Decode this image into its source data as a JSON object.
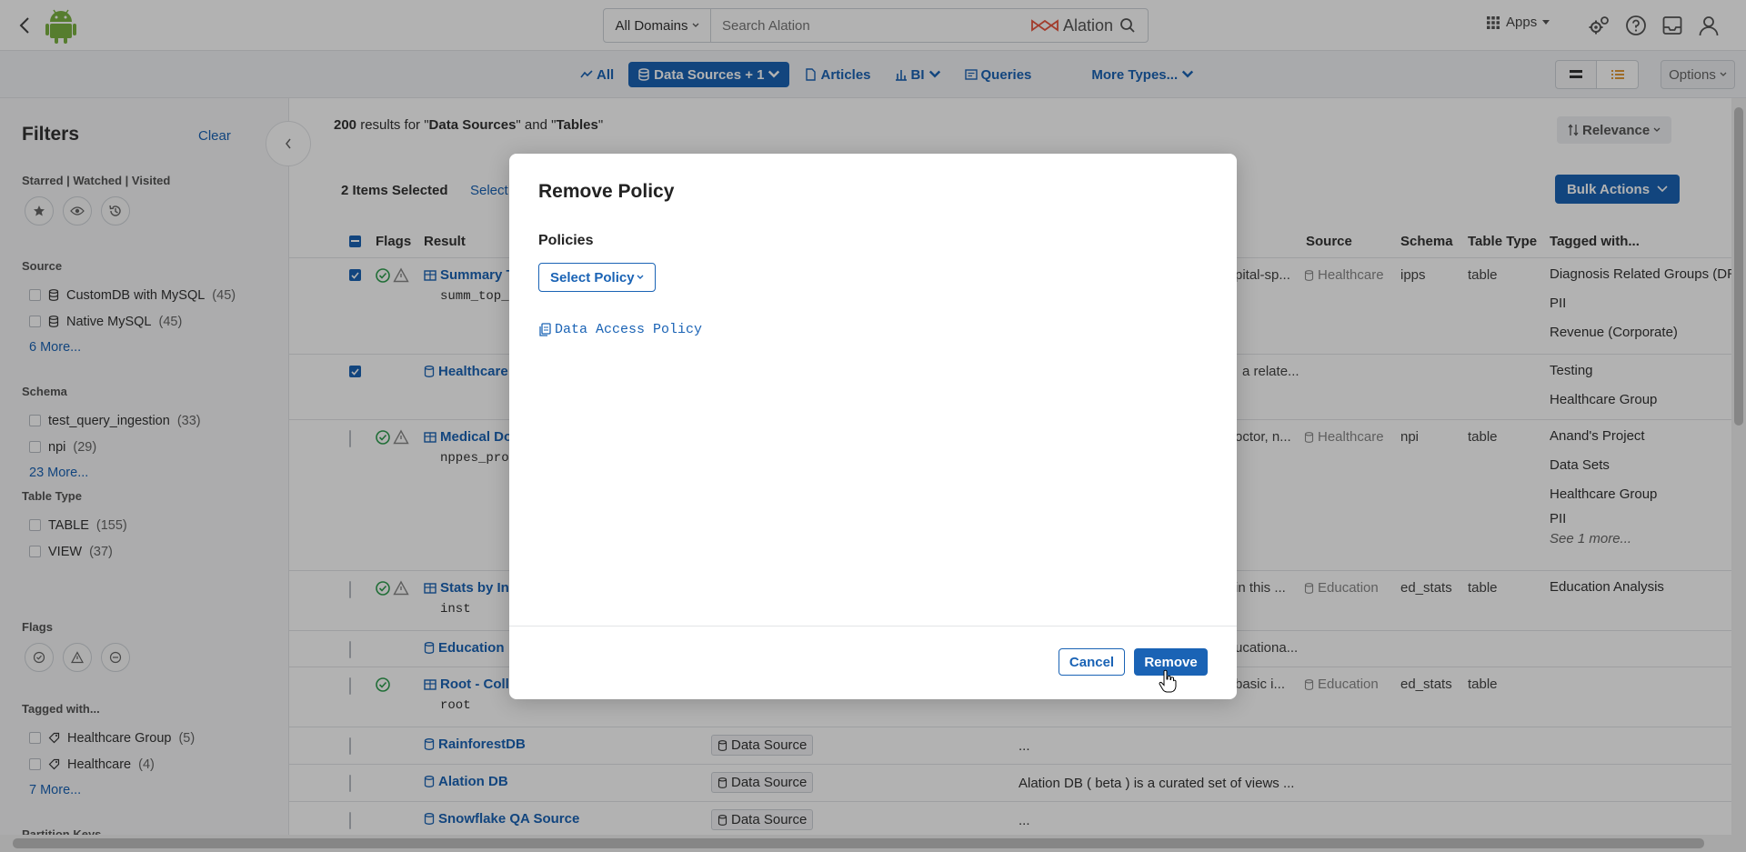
{
  "header": {
    "domain_select": "All Domains",
    "search_placeholder": "Search Alation",
    "brand": "Alation",
    "apps_label": "Apps"
  },
  "type_tabs": [
    {
      "label": "All"
    },
    {
      "label": "Data Sources + 1"
    },
    {
      "label": "Articles"
    },
    {
      "label": "BI"
    },
    {
      "label": "Queries"
    },
    {
      "label": "More Types..."
    }
  ],
  "options_label": "Options",
  "sidebar": {
    "title": "Filters",
    "clear": "Clear",
    "starred_label": "Starred | Watched | Visited",
    "source": {
      "label": "Source",
      "items": [
        {
          "name": "CustomDB with MySQL",
          "count": "(45)"
        },
        {
          "name": "Native MySQL",
          "count": "(45)"
        }
      ],
      "more": "6 More..."
    },
    "schema": {
      "label": "Schema",
      "items": [
        {
          "name": "test_query_ingestion",
          "count": "(33)"
        },
        {
          "name": "npi",
          "count": "(29)"
        }
      ],
      "more": "23 More..."
    },
    "table_type": {
      "label": "Table Type",
      "items": [
        {
          "name": "TABLE",
          "count": "(155)"
        },
        {
          "name": "VIEW",
          "count": "(37)"
        }
      ]
    },
    "flags_label": "Flags",
    "tagged": {
      "label": "Tagged with...",
      "items": [
        {
          "name": "Healthcare Group",
          "count": "(5)"
        },
        {
          "name": "Healthcare",
          "count": "(4)"
        }
      ],
      "more": "7 More..."
    },
    "partition_label": "Partition Keys"
  },
  "results": {
    "count": "200",
    "text_mid": " results for \"",
    "term1": "Data Sources",
    "text_and": "\" and \"",
    "term2": "Tables",
    "text_end": "\"",
    "relevance": "Relevance",
    "selected": "2 Items Selected",
    "select_link": "Select",
    "bulk_actions": "Bulk Actions"
  },
  "table": {
    "headers": {
      "flags": "Flags",
      "result": "Result",
      "source": "Source",
      "schema": "Schema",
      "table_type": "Table Type",
      "tagged": "Tagged with..."
    },
    "rows": [
      {
        "title": "Summary T",
        "code": "summ_top_",
        "desc": "pital-sp...",
        "source": "Healthcare",
        "schema": "ipps",
        "type": "table",
        "tags": [
          "Diagnosis Related Groups (DR",
          "PII",
          "Revenue (Corporate)"
        ]
      },
      {
        "title": "Healthcare",
        "desc": "a relate...",
        "tags": [
          "Testing",
          "Healthcare Group"
        ]
      },
      {
        "title": "Medical Do",
        "code": "nppes_pro",
        "desc": "octor, n...",
        "source": "Healthcare",
        "schema": "npi",
        "type": "table",
        "tags": [
          "Anand's Project",
          "Data Sets",
          "Healthcare Group",
          "PII"
        ],
        "see_more": "See 1 more..."
      },
      {
        "title": "Stats by Ins",
        "code": "inst",
        "desc": "in this ...",
        "source": "Education",
        "schema": "ed_stats",
        "type": "table",
        "tags": [
          "Education Analysis"
        ]
      },
      {
        "title": "Education",
        "desc": "ucationa..."
      },
      {
        "title": "Root - Colle",
        "code": "root",
        "desc": "basic i...",
        "source": "Education",
        "schema": "ed_stats",
        "type": "table"
      },
      {
        "title": "RainforestDB",
        "badge": "Data Source",
        "desc": "..."
      },
      {
        "title": "Alation DB",
        "badge": "Data Source",
        "desc": "Alation DB ( beta ) is a curated set of views ..."
      },
      {
        "title": "Snowflake QA Source",
        "badge": "Data Source",
        "desc": "..."
      }
    ]
  },
  "modal": {
    "title": "Remove Policy",
    "policies_label": "Policies",
    "select_policy": "Select Policy",
    "policy_item": "Data Access Policy",
    "cancel": "Cancel",
    "remove": "Remove"
  },
  "colors": {
    "accent": "#1a63b5",
    "success": "#2e9e4f",
    "warning": "#888888"
  }
}
